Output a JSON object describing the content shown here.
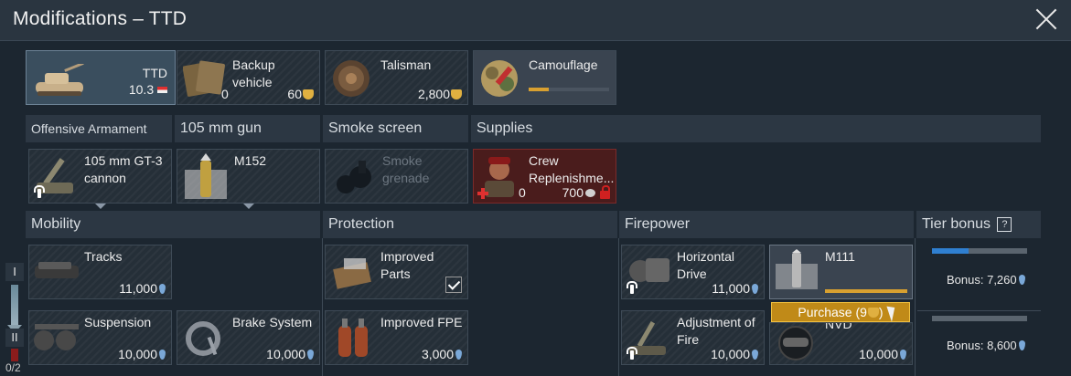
{
  "window": {
    "title": "Modifications – TTD"
  },
  "top_row": [
    {
      "name": "TTD",
      "value": "10.3",
      "value2": ""
    },
    {
      "name": "Backup vehicle",
      "count": "0",
      "value": "60"
    },
    {
      "name": "Talisman",
      "value": "2,800"
    },
    {
      "name": "Camouflage",
      "progress": 0.25
    }
  ],
  "categories": {
    "offensive": "Offensive Armament",
    "gun": "105 mm gun",
    "smoke": "Smoke screen",
    "supplies": "Supplies",
    "mobility": "Mobility",
    "protection": "Protection",
    "firepower": "Firepower",
    "tier_bonus": "Tier bonus",
    "tier_help": "?"
  },
  "weapons": [
    {
      "name": "105 mm GT-3 cannon"
    },
    {
      "name": "M152"
    },
    {
      "name": "Smoke grenade"
    },
    {
      "name": "Crew Replenishme...",
      "count": "0",
      "value": "700"
    }
  ],
  "mods": {
    "tracks": {
      "name": "Tracks",
      "value": "11,000"
    },
    "suspension": {
      "name": "Suspension",
      "value": "10,000"
    },
    "brake": {
      "name": "Brake System",
      "value": "10,000"
    },
    "parts": {
      "name": "Improved Parts"
    },
    "fpe": {
      "name": "Improved FPE",
      "value": "3,000"
    },
    "horizontal": {
      "name": "Horizontal Drive",
      "value": "11,000"
    },
    "m111": {
      "name": "M111",
      "purchase": "Purchase (9",
      "purchase_end": ")"
    },
    "adjustment": {
      "name": "Adjustment of Fire",
      "value": "10,000"
    },
    "nvd": {
      "name": "NVD",
      "value": "10,000"
    }
  },
  "tiers": [
    {
      "label": "Bonus: 7,260",
      "progress": 0.38
    },
    {
      "label": "Bonus: 8,600",
      "progress": 0.0
    }
  ],
  "rank": {
    "tier1": "I",
    "tier2": "II",
    "count": "0/2"
  },
  "colors": {
    "eagle": "#e0b040",
    "rp": "#7aa8d8",
    "purchase": "#c08a18"
  }
}
